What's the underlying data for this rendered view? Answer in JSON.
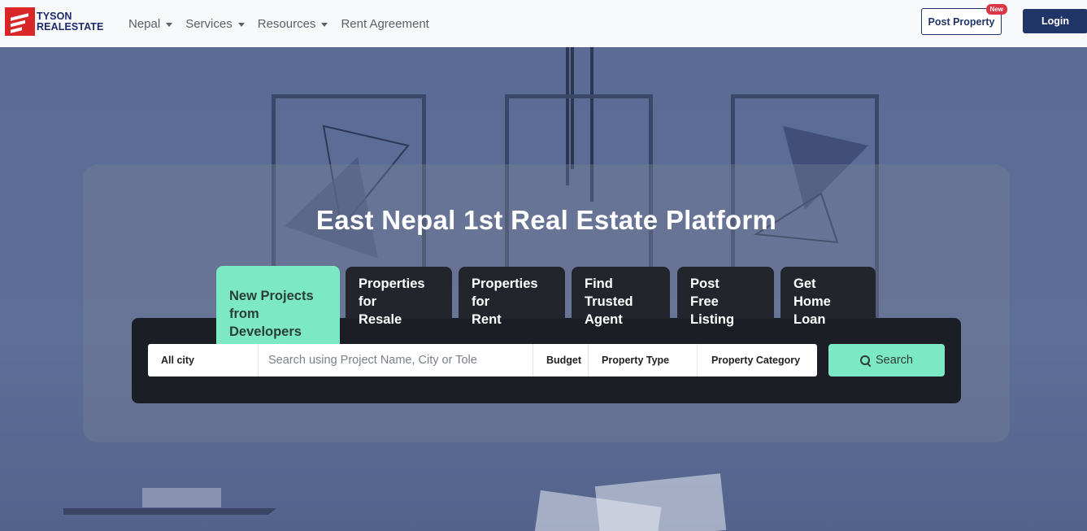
{
  "brand": {
    "line1": "TYSON",
    "line2": "REALESTATE"
  },
  "nav": [
    {
      "label": "Nepal",
      "dropdown": true
    },
    {
      "label": "Services",
      "dropdown": true
    },
    {
      "label": "Resources",
      "dropdown": true
    },
    {
      "label": "Rent Agreement",
      "dropdown": false
    }
  ],
  "header": {
    "post_property": "Post Property",
    "new_badge": "New",
    "login": "Login"
  },
  "hero": {
    "title": "East Nepal 1st Real Estate Platform"
  },
  "tabs": [
    {
      "line1": "New Projects",
      "line2": "from Developers",
      "active": true
    },
    {
      "line1": "Properties for",
      "line2": "Resale",
      "active": false
    },
    {
      "line1": "Properties for",
      "line2": "Rent",
      "active": false
    },
    {
      "line1": "Find Trusted",
      "line2": "Agent",
      "active": false
    },
    {
      "line1": "Post",
      "line2": "Free Listing",
      "active": false
    },
    {
      "line1": "Get",
      "line2": "Home Loan",
      "active": false
    }
  ],
  "search": {
    "city": "All city",
    "placeholder": "Search using Project Name, City or Tole",
    "budget": "Budget",
    "property_type": "Property Type",
    "property_category": "Property Category",
    "button": "Search"
  },
  "colors": {
    "accent": "#7de8c4",
    "navy": "#1f3567",
    "brand_red": "#d92626",
    "panel": "#1b1e25"
  },
  "icons": {
    "logo": "tyson-logo-icon",
    "search": "search-icon",
    "caret": "caret-down-icon"
  }
}
